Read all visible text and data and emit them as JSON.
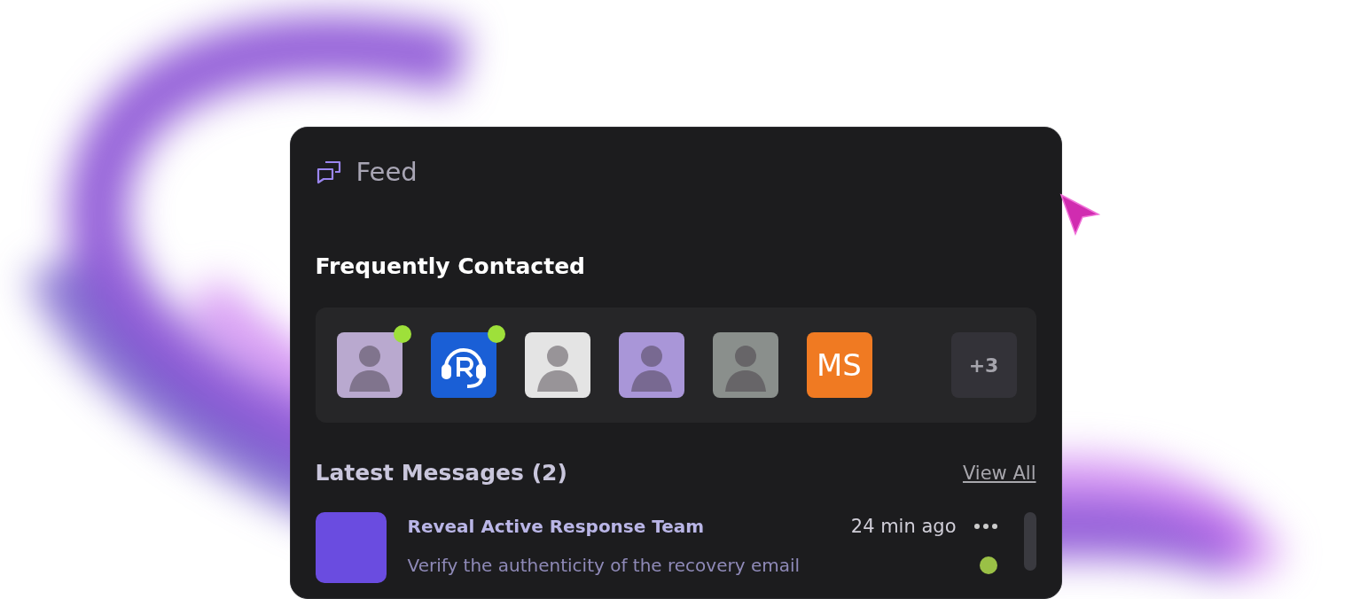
{
  "panel": {
    "title": "Feed"
  },
  "frequently_contacted": {
    "heading": "Frequently Contacted",
    "contacts": [
      {
        "kind": "photo",
        "online": true,
        "color": "#b9a9cf"
      },
      {
        "kind": "logo",
        "online": true,
        "color": "#1a5fd6"
      },
      {
        "kind": "photo",
        "online": false,
        "color": "#e4e4e4"
      },
      {
        "kind": "photo",
        "online": false,
        "color": "#a996d8"
      },
      {
        "kind": "photo",
        "online": false,
        "color": "#8a8f8c"
      },
      {
        "kind": "initials",
        "label": "MS",
        "online": false,
        "color": "#f07a22"
      },
      {
        "kind": "more",
        "label": "+3",
        "online": false,
        "color": "#333238"
      }
    ]
  },
  "latest_messages": {
    "heading": "Latest Messages (2)",
    "link": "View All",
    "messages": [
      {
        "sender": "Reveal Active Response Team",
        "time": "24 min ago",
        "preview": "Verify the authenticity of the recovery email",
        "unread": true
      }
    ]
  }
}
